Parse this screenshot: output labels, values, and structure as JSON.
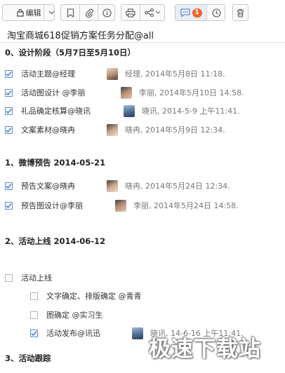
{
  "toolbar": {
    "edit_label": "编辑"
  },
  "comment_count": "1",
  "doc_title": "淘宝商城618促销方案任务分配@all",
  "sections": [
    {
      "title": "0、设计阶段（5月7日至5月10日）"
    },
    {
      "title": "1、微博预告 2014-05-21"
    },
    {
      "title": "2、活动上线  2014-06-12"
    },
    {
      "title": "3、活动跟踪"
    }
  ],
  "tasks": [
    {
      "name": "活动主题@经理",
      "checked": true,
      "meta": "经理, 2014年5月8日 11:18."
    },
    {
      "name": "活动图设计  @李丽",
      "checked": true,
      "meta": "李丽, 2014年5月10日 14:58."
    },
    {
      "name": "礼品确定核算@晓讯",
      "checked": true,
      "meta": "晓讯, 2014-5-9 上午11:41."
    },
    {
      "name": "文案素材@晓冉",
      "checked": true,
      "meta": "晓冉, 2014年5月9日 12:34."
    },
    {
      "name": "预告文案@晓冉",
      "checked": true,
      "meta": "晓冉, 2014年5月24日 12:34."
    },
    {
      "name": "预告图设计@李丽",
      "checked": true,
      "meta": "李丽, 2014年5月24日 14:58."
    },
    {
      "name": "活动上线",
      "checked": false
    },
    {
      "name": "文字确定、排版确定 @青青",
      "checked": false
    },
    {
      "name": "图确定  @实习生",
      "checked": false
    },
    {
      "name": "活动发布@讯迅",
      "checked": true,
      "meta": "晓讯, 14-6-16 上午11:41."
    }
  ],
  "watermark": "极速下载站",
  "colors": {
    "checkbox_checked": "#5a8fd0",
    "badge": "#f0642d",
    "meta_text": "#777777"
  }
}
